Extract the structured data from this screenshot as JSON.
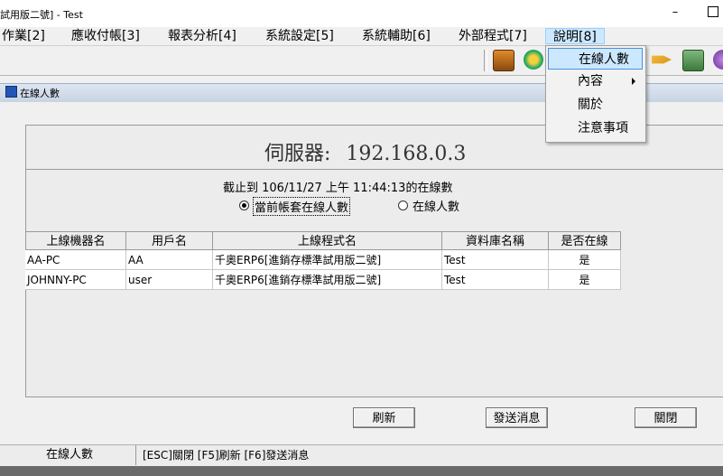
{
  "window": {
    "title": "試用版二號] - Test",
    "minimize": "–"
  },
  "menu": {
    "items": [
      "作業[2]",
      "應收付帳[3]",
      "報表分析[4]",
      "系統設定[5]",
      "系統輔助[6]",
      "外部程式[7]",
      "說明[8]"
    ],
    "dropdown": [
      "在線人數",
      "內容",
      "關於",
      "注意事項"
    ]
  },
  "toolbar": {
    "icons": [
      "book-icon",
      "recycle-icon",
      "tag-icon",
      "money-icon",
      "globe-icon"
    ]
  },
  "child_window": {
    "title": "在線人數"
  },
  "server": {
    "label": "伺服器:",
    "address": "192.168.0.3"
  },
  "stats": {
    "text": "截止到  106/11/27 上午 11:44:13的在線數"
  },
  "radio": {
    "option1": "當前帳套在線人數",
    "option2": "在線人數",
    "selected": "option1"
  },
  "table": {
    "headers": [
      "上線機器名",
      "用戶名",
      "上線程式名",
      "資料庫名稱",
      "是否在線"
    ],
    "rows": [
      [
        "AA-PC",
        "AA",
        "千奧ERP6[進銷存標準試用版二號]",
        "Test",
        "是"
      ],
      [
        "JOHNNY-PC",
        "user",
        "千奧ERP6[進銷存標準試用版二號]",
        "Test",
        "是"
      ]
    ]
  },
  "buttons": {
    "refresh": "刷新",
    "send": "發送消息",
    "close": "關閉"
  },
  "status": {
    "left": "在線人數",
    "right": "[ESC]關閉 [F5]刷新 [F6]發送消息"
  }
}
